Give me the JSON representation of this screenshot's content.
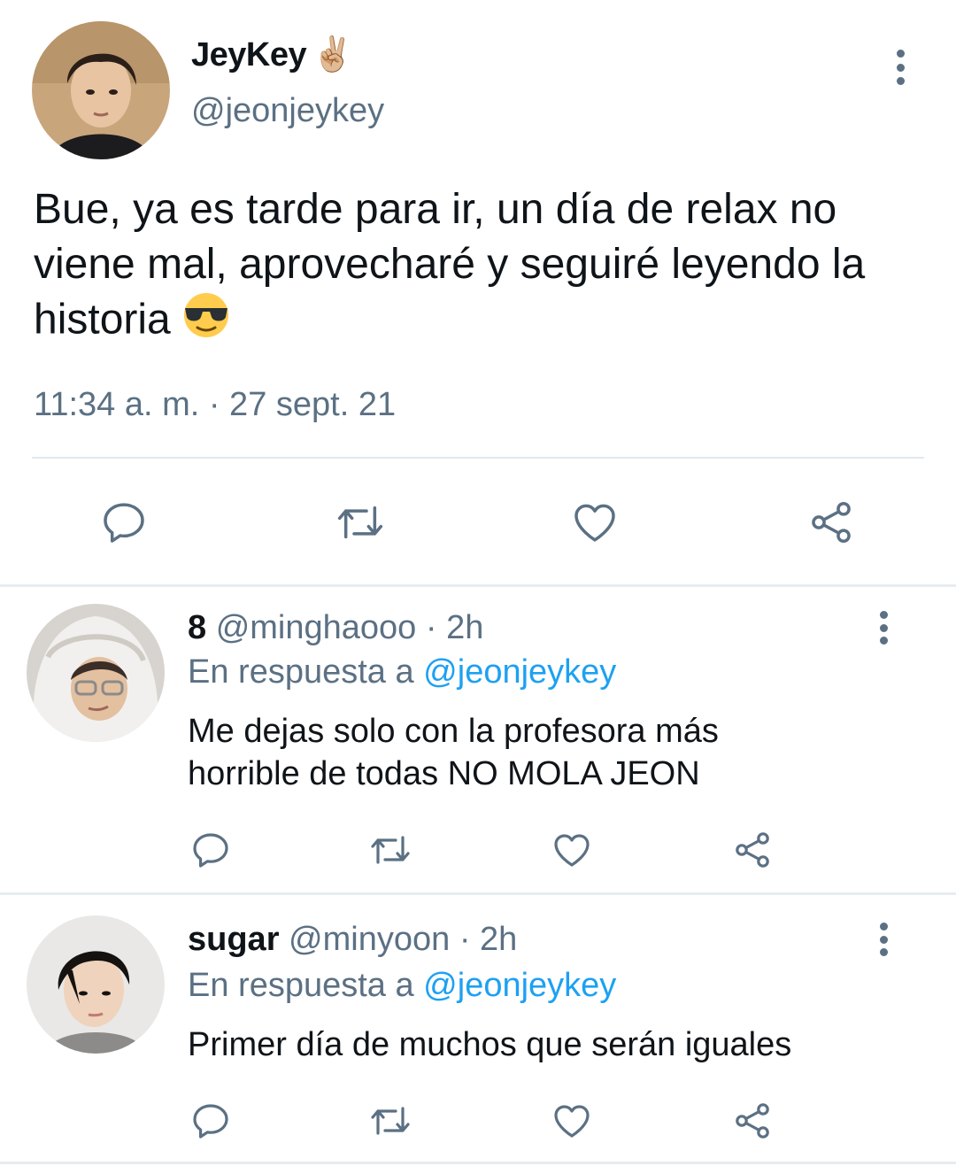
{
  "main_tweet": {
    "name": "JeyKey",
    "name_emoji": "✌🏼",
    "handle": "@jeonjeykey",
    "text": "Bue, ya es tarde para ir, un día de relax no viene mal, aprovecharé y seguiré leyendo la historia",
    "text_emoji": "😎",
    "timestamp": "11:34 a. m. · 27 sept. 21",
    "actions": [
      "reply-icon",
      "retweet-icon",
      "like-icon",
      "share-icon"
    ]
  },
  "replies": [
    {
      "name": "8",
      "handle": "@minghaooo",
      "time": "· 2h",
      "reply_prefix": "En respuesta a",
      "reply_mention": "@jeonjeykey",
      "text_lines": [
        "Me dejas solo con la profesora más",
        "horrible de todas NO MOLA JEON"
      ]
    },
    {
      "name": "sugar",
      "handle": "@minyoon",
      "time": "· 2h",
      "reply_prefix": "En respuesta a",
      "reply_mention": "@jeonjeykey",
      "text_lines": [
        "Primer día de muchos que serán iguales"
      ]
    }
  ],
  "colors": {
    "text": "#0f1419",
    "secondary": "#5b7083",
    "link": "#1da1f2",
    "divider": "#e6ecf0"
  }
}
